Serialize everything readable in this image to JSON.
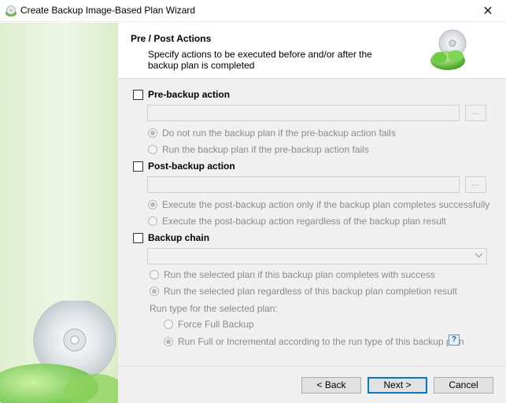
{
  "window": {
    "title": "Create Backup Image-Based Plan Wizard",
    "close_glyph": "✕"
  },
  "header": {
    "title": "Pre / Post Actions",
    "description": "Specify actions to be executed before and/or after the backup plan is completed"
  },
  "pre_backup": {
    "label": "Pre-backup action",
    "command_value": "",
    "browse_label": "...",
    "options": [
      {
        "label": "Do not run the backup plan if the pre-backup action fails",
        "checked": true
      },
      {
        "label": "Run the backup plan if the pre-backup action fails",
        "checked": false
      }
    ]
  },
  "post_backup": {
    "label": "Post-backup action",
    "command_value": "",
    "browse_label": "...",
    "options": [
      {
        "label": "Execute the post-backup action only if the backup plan completes successfully",
        "checked": true
      },
      {
        "label": "Execute the post-backup action regardless of the backup plan result",
        "checked": false
      }
    ]
  },
  "backup_chain": {
    "label": "Backup chain",
    "selected_plan": "",
    "options": [
      {
        "label": "Run the selected plan if this backup plan completes with success",
        "checked": false
      },
      {
        "label": "Run the selected plan regardless of this backup plan completion result",
        "checked": true
      }
    ],
    "run_type_label": "Run type for the selected plan:",
    "run_type_options": [
      {
        "label": "Force Full Backup",
        "checked": false
      },
      {
        "label": "Run Full or Incremental according to the run type of this backup plan",
        "checked": true
      }
    ],
    "help_glyph": "?"
  },
  "footer": {
    "back_label": "< Back",
    "next_label": "Next >",
    "cancel_label": "Cancel"
  },
  "colors": {
    "accent": "#0078d7",
    "brand_green": "#5fbf3a",
    "disabled_text": "#8a8a8a"
  },
  "icons": [
    "app-disc-icon",
    "close-icon",
    "backup-disc-icon",
    "browse-icon",
    "chevron-down-icon",
    "help-icon"
  ]
}
